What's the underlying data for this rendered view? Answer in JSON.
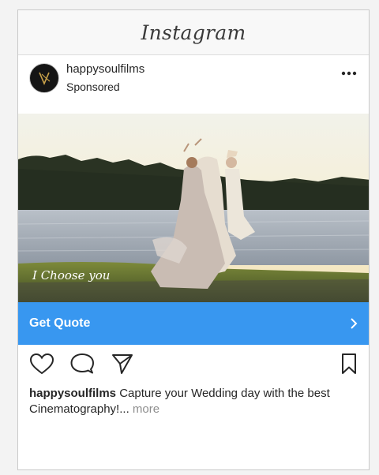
{
  "app": {
    "logo_text": "Instagram"
  },
  "post": {
    "username": "happysoulfilms",
    "sponsored_label": "Sponsored",
    "image_overlay_text": "I Choose you",
    "cta_label": "Get Quote",
    "caption_username": "happysoulfilms",
    "caption_text": "Capture your Wedding day with the best Cinematography!...",
    "more_label": "more"
  },
  "icons": {
    "more": "more-options-icon",
    "like": "heart-icon",
    "comment": "comment-icon",
    "share": "share-icon",
    "save": "bookmark-icon",
    "cta_arrow": "chevron-right-icon"
  },
  "colors": {
    "cta_background": "#3897f0",
    "text": "#262626",
    "muted": "#8e8e8e"
  }
}
